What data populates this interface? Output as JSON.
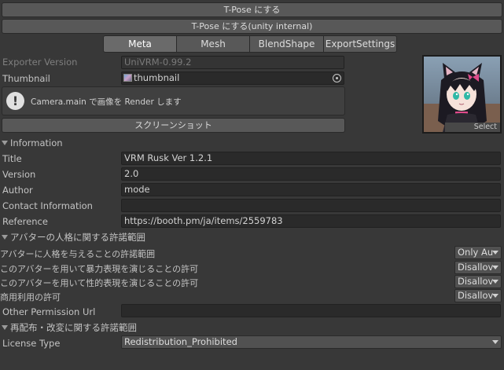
{
  "toolbar": {
    "tpose_button": "T-Pose にする",
    "tpose_internal_button": "T-Pose にする(unity internal)"
  },
  "tabs": [
    {
      "label": "Meta",
      "active": true
    },
    {
      "label": "Mesh",
      "active": false
    },
    {
      "label": "BlendShape",
      "active": false
    },
    {
      "label": "ExportSettings",
      "active": false
    }
  ],
  "meta": {
    "exporter_version_label": "Exporter Version",
    "exporter_version_value": "UniVRM-0.99.2",
    "thumbnail_label": "Thumbnail",
    "thumbnail_value": "thumbnail",
    "help_message": "Camera.main で画像を Render します",
    "screenshot_button": "スクリーンショット",
    "preview_select": "Select"
  },
  "information": {
    "header": "Information",
    "title_label": "Title",
    "title_value": "VRM Rusk Ver 1.2.1",
    "version_label": "Version",
    "version_value": "2.0",
    "author_label": "Author",
    "author_value": "mode",
    "contact_label": "Contact Information",
    "contact_value": "",
    "reference_label": "Reference",
    "reference_value": "https://booth.pm/ja/items/2559783"
  },
  "permission": {
    "header": "アバターの人格に関する許諾範囲",
    "allowed_user_label": "アバターに人格を与えることの許諾範囲",
    "allowed_user_value": "Only Au",
    "violence_label": "このアバターを用いて暴力表現を演じることの許可",
    "violence_value": "Disallov",
    "sexual_label": "このアバターを用いて性的表現を演じることの許可",
    "sexual_value": "Disallov",
    "commercial_label": "商用利用の許可",
    "commercial_value": "Disallov",
    "other_url_label": "Other Permission Url",
    "other_url_value": ""
  },
  "license": {
    "header": "再配布・改変に関する許諾範囲",
    "type_label": "License Type",
    "type_value": "Redistribution_Prohibited"
  },
  "colors": {
    "background": "#383838",
    "field": "#2a2a2a",
    "button": "#585858"
  }
}
